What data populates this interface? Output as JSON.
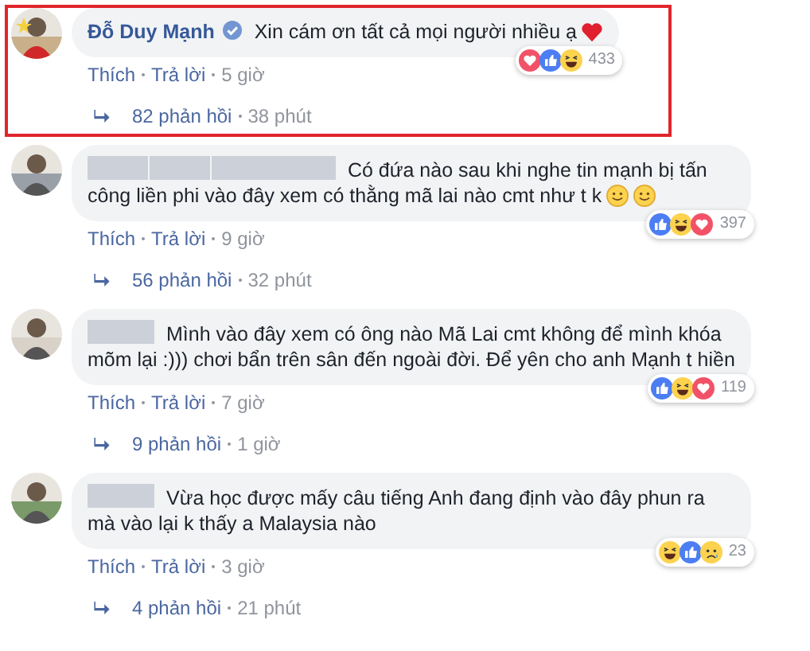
{
  "comments": [
    {
      "highlighted": true,
      "author": {
        "name": "Đỗ Duy Mạnh",
        "verified": true
      },
      "text": "Xin cám ơn tất cả mọi người nhiều ạ",
      "trailing_emoji": [
        {
          "kind": "heart"
        }
      ],
      "reactions": {
        "icons": [
          {
            "kind": "love"
          },
          {
            "kind": "like"
          },
          {
            "kind": "haha"
          }
        ],
        "count": "433"
      },
      "actions": [
        "Thích",
        "Trả lời"
      ],
      "time": "5 giờ",
      "replies": {
        "count": "82 phản hồi",
        "time": "38 phút"
      }
    },
    {
      "highlighted": false,
      "author": {
        "redacted_parts": [
          {
            "kind": "short"
          },
          {
            "kind": "short"
          },
          {
            "kind": "long"
          }
        ]
      },
      "text": "Có đứa nào sau khi nghe tin mạnh bị tấn công liền phi vào đây xem có thằng mã lai nào cmt như t k",
      "trailing_emoji": [
        {
          "kind": "smile"
        },
        {
          "kind": "smile"
        }
      ],
      "reactions": {
        "icons": [
          {
            "kind": "like"
          },
          {
            "kind": "haha"
          },
          {
            "kind": "love"
          }
        ],
        "count": "397"
      },
      "actions": [
        "Thích",
        "Trả lời"
      ],
      "time": "9 giờ",
      "replies": {
        "count": "56 phản hồi",
        "time": "32 phút"
      }
    },
    {
      "highlighted": false,
      "author": {
        "redacted_parts": [
          {
            "kind": "medium"
          }
        ]
      },
      "text": "Mình vào đây xem có ông nào Mã Lai cmt không để mình khóa mõm lại :))) chơi bẩn trên sân đến ngoài đời. Để yên cho anh Mạnh t hiền",
      "reactions": {
        "icons": [
          {
            "kind": "like"
          },
          {
            "kind": "haha"
          },
          {
            "kind": "love"
          }
        ],
        "count": "119"
      },
      "actions": [
        "Thích",
        "Trả lời"
      ],
      "time": "7 giờ",
      "replies": {
        "count": "9 phản hồi",
        "time": "1 giờ"
      }
    },
    {
      "highlighted": false,
      "author": {
        "redacted_parts": [
          {
            "kind": "medium"
          }
        ]
      },
      "text": "Vừa học được mấy câu tiếng Anh đang định vào đây phun ra mà vào lại k thấy a Malaysia nào",
      "reactions": {
        "icons": [
          {
            "kind": "haha"
          },
          {
            "kind": "like"
          },
          {
            "kind": "sad"
          }
        ],
        "count": "23"
      },
      "actions": [
        "Thích",
        "Trả lời"
      ],
      "time": "3 giờ",
      "replies": {
        "count": "4 phản hồi",
        "time": "21 phút"
      }
    }
  ]
}
